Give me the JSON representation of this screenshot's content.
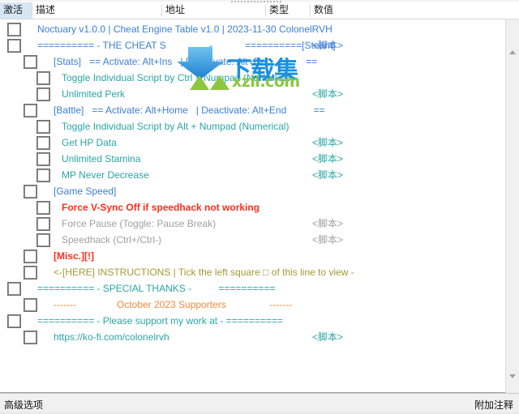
{
  "window": {
    "columns": [
      {
        "key": "activate",
        "label": "激活"
      },
      {
        "key": "description",
        "label": "描述"
      },
      {
        "key": "address",
        "label": "地址"
      },
      {
        "key": "type",
        "label": "类型"
      },
      {
        "key": "value",
        "label": "数值"
      }
    ]
  },
  "colors": {
    "blue": "#3a7fd5",
    "teal": "#2aa5a5",
    "red": "#ff2d1a",
    "gray": "#a0a0a0",
    "olive": "#a39a33",
    "orange": "#f08a3c",
    "header_highlight": "#d6e6f5",
    "watermark_blue": "#1b8fe0",
    "watermark_green": "#8dc63f"
  },
  "rows": [
    {
      "level": 1,
      "checked": false,
      "text": "Noctuary v1.0.0 | Cheat Engine Table v1.0 | 2023-11-30 ColonelRVH",
      "type": "",
      "color": "blue",
      "bold": false
    },
    {
      "level": 1,
      "checked": false,
      "text": "========== - THE CHEAT S                -            ==========[Steam]",
      "type": "<脚本>",
      "color": "blue",
      "bold": false
    },
    {
      "level": 2,
      "checked": false,
      "text": "[Stats]   == Activate: Alt+Ins   | Deactivate: Alt+Del              ==",
      "type": "",
      "color": "blue",
      "bold": false
    },
    {
      "level": 3,
      "checked": false,
      "text": "Toggle Individual Script by Ctrl + Numpad (Numerical)",
      "type": "",
      "color": "teal",
      "bold": false
    },
    {
      "level": 3,
      "checked": false,
      "text": "Unlimited Perk",
      "type": "<脚本>",
      "color": "teal",
      "bold": false
    },
    {
      "level": 2,
      "checked": false,
      "text": "[Battle]   == Activate: Alt+Home   | Deactivate: Alt+End          ==",
      "type": "",
      "color": "blue",
      "bold": false
    },
    {
      "level": 3,
      "checked": false,
      "text": "Toggle Individual Script by Alt + Numpad (Numerical)",
      "type": "",
      "color": "teal",
      "bold": false
    },
    {
      "level": 3,
      "checked": false,
      "text": "Get HP Data",
      "type": "<脚本>",
      "color": "teal",
      "bold": false
    },
    {
      "level": 3,
      "checked": false,
      "text": "Unlimited Stamina",
      "type": "<脚本>",
      "color": "teal",
      "bold": false
    },
    {
      "level": 3,
      "checked": false,
      "text": "MP Never Decrease",
      "type": "<脚本>",
      "color": "teal",
      "bold": false
    },
    {
      "level": 2,
      "checked": false,
      "text": "[Game Speed]",
      "type": "",
      "color": "blue",
      "bold": false
    },
    {
      "level": 3,
      "checked": false,
      "text": "Force V-Sync Off if speedhack not working",
      "type": "",
      "color": "red",
      "bold": true
    },
    {
      "level": 3,
      "checked": false,
      "text": "Force Pause (Toggle: Pause Break)",
      "type": "<脚本>",
      "color": "gray",
      "bold": false
    },
    {
      "level": 3,
      "checked": false,
      "text": "Speedhack (Ctrl+/Ctrl-)",
      "type": "<脚本>",
      "color": "gray",
      "bold": false
    },
    {
      "level": 2,
      "checked": false,
      "text": "[Misc.][!]",
      "type": "",
      "color": "red",
      "bold": true
    },
    {
      "level": 2,
      "checked": false,
      "text": "<-[HERE] INSTRUCTIONS | Tick the left square □ of this line to view -",
      "type": "",
      "color": "olive",
      "bold": false
    },
    {
      "level": 1,
      "checked": false,
      "text": "========== - SPECIAL THANKS -          ==========",
      "type": "",
      "color": "teal",
      "bold": false
    },
    {
      "level": 2,
      "checked": false,
      "text": "-------               October 2023 Supporters                -------",
      "type": "",
      "color": "orange",
      "bold": false
    },
    {
      "level": 1,
      "checked": false,
      "text": "========== - Please support my work at - ==========",
      "type": "",
      "color": "teal",
      "bold": false
    },
    {
      "level": 2,
      "checked": false,
      "text": "https://ko-fi.com/colonelrvh",
      "type": "<脚本>",
      "color": "teal",
      "bold": false
    }
  ],
  "status_bar": {
    "advanced_options": "高级选项",
    "extra_notes": "附加注释"
  },
  "watermark": {
    "title_cn": "下载集",
    "site": "xzii.com"
  },
  "scrollbar": {
    "up_arrow": "scroll-up-arrow",
    "down_arrow": "scroll-down-arrow"
  }
}
